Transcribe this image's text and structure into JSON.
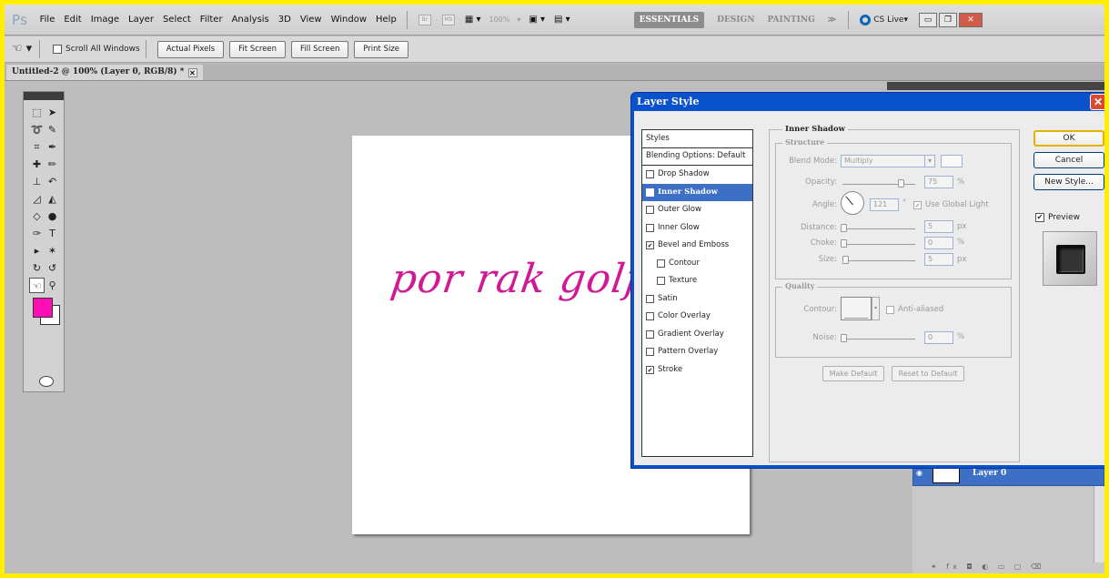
{
  "app": {
    "logo": "Ps",
    "menu": [
      "File",
      "Edit",
      "Image",
      "Layer",
      "Select",
      "Filter",
      "Analysis",
      "3D",
      "View",
      "Window",
      "Help"
    ],
    "bridge_badge": "Br",
    "mini_badge": "Mb",
    "zoom": "100%",
    "workspaces": [
      "ESSENTIALS",
      "DESIGN",
      "PAINTING",
      "≫"
    ],
    "cs_live": "CS Live"
  },
  "options_bar": {
    "scroll_all_windows": "Scroll All Windows",
    "buttons": [
      "Actual Pixels",
      "Fit Screen",
      "Fill Screen",
      "Print Size"
    ]
  },
  "document": {
    "tab_title": "Untitled-2 @ 100% (Layer 0, RGB/8) *",
    "canvas_text": "por rak golf"
  },
  "colors": {
    "foreground": "#ff0fb4",
    "background": "#ffffff",
    "dialog_title_bar": "#0a52cc",
    "selection": "#3d6fc5"
  },
  "layers": {
    "layer_name": "Layer 0"
  },
  "dialog": {
    "title": "Layer Style",
    "styles_header": "Styles",
    "blending_options": "Blending Options: Default",
    "items": [
      {
        "label": "Drop Shadow",
        "checked": false,
        "sub": false
      },
      {
        "label": "Inner Shadow",
        "checked": false,
        "sub": false,
        "selected": true
      },
      {
        "label": "Outer Glow",
        "checked": false,
        "sub": false
      },
      {
        "label": "Inner Glow",
        "checked": false,
        "sub": false
      },
      {
        "label": "Bevel and Emboss",
        "checked": true,
        "sub": false
      },
      {
        "label": "Contour",
        "checked": false,
        "sub": true
      },
      {
        "label": "Texture",
        "checked": false,
        "sub": true
      },
      {
        "label": "Satin",
        "checked": false,
        "sub": false
      },
      {
        "label": "Color Overlay",
        "checked": false,
        "sub": false
      },
      {
        "label": "Gradient Overlay",
        "checked": false,
        "sub": false
      },
      {
        "label": "Pattern Overlay",
        "checked": false,
        "sub": false
      },
      {
        "label": "Stroke",
        "checked": true,
        "sub": false
      }
    ],
    "section_title": "Inner Shadow",
    "structure": {
      "title": "Structure",
      "blend_mode_label": "Blend Mode:",
      "blend_mode_value": "Multiply",
      "opacity_label": "Opacity:",
      "opacity_value": "75",
      "opacity_unit": "%",
      "angle_label": "Angle:",
      "angle_value": "121",
      "angle_unit": "°",
      "use_global_light": "Use Global Light",
      "distance_label": "Distance:",
      "distance_value": "5",
      "distance_unit": "px",
      "choke_label": "Choke:",
      "choke_value": "0",
      "choke_unit": "%",
      "size_label": "Size:",
      "size_value": "5",
      "size_unit": "px"
    },
    "quality": {
      "title": "Quality",
      "contour_label": "Contour:",
      "anti_aliased": "Anti-aliased",
      "noise_label": "Noise:",
      "noise_value": "0",
      "noise_unit": "%"
    },
    "make_default": "Make Default",
    "reset_default": "Reset to Default",
    "ok": "OK",
    "cancel": "Cancel",
    "new_style": "New Style...",
    "preview": "Preview"
  }
}
